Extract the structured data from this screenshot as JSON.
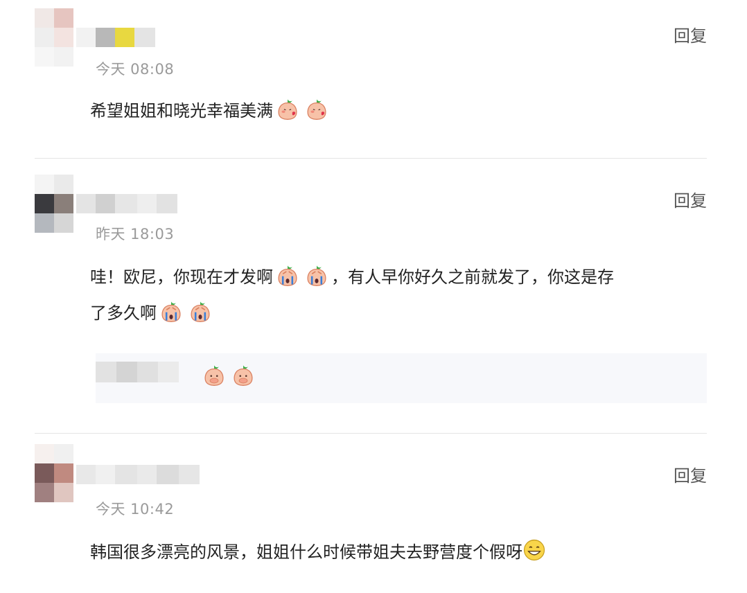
{
  "comments": [
    {
      "time": "今天 08:08",
      "reply_label": "回复",
      "text": "希望姐姐和晓光幸福美满",
      "emoji": [
        "peach-kiss-icon",
        "peach-kiss-icon"
      ]
    },
    {
      "time": "昨天 18:03",
      "reply_label": "回复",
      "text_line1": "哇！欧尼，你现在才发啊",
      "text_line1b": "，有人早你好久之前就发了，你这是存",
      "text_line2": "了多久啊",
      "emoji": [
        "peach-cry-icon",
        "peach-cry-icon"
      ],
      "sub_reply_emoji": [
        "peach-shy-icon",
        "peach-shy-icon"
      ]
    },
    {
      "time": "今天 10:42",
      "reply_label": "回复",
      "text": "韩国很多漂亮的风景，姐姐什么时候带姐夫去野营度个假呀",
      "emoji": [
        "grin-icon"
      ]
    }
  ],
  "colors": {
    "background": "#ffffff",
    "text": "#222222",
    "time": "#9a9a9a",
    "divider": "#e4e4e4",
    "peach": "#f4a98f",
    "leaf": "#4caf50"
  }
}
